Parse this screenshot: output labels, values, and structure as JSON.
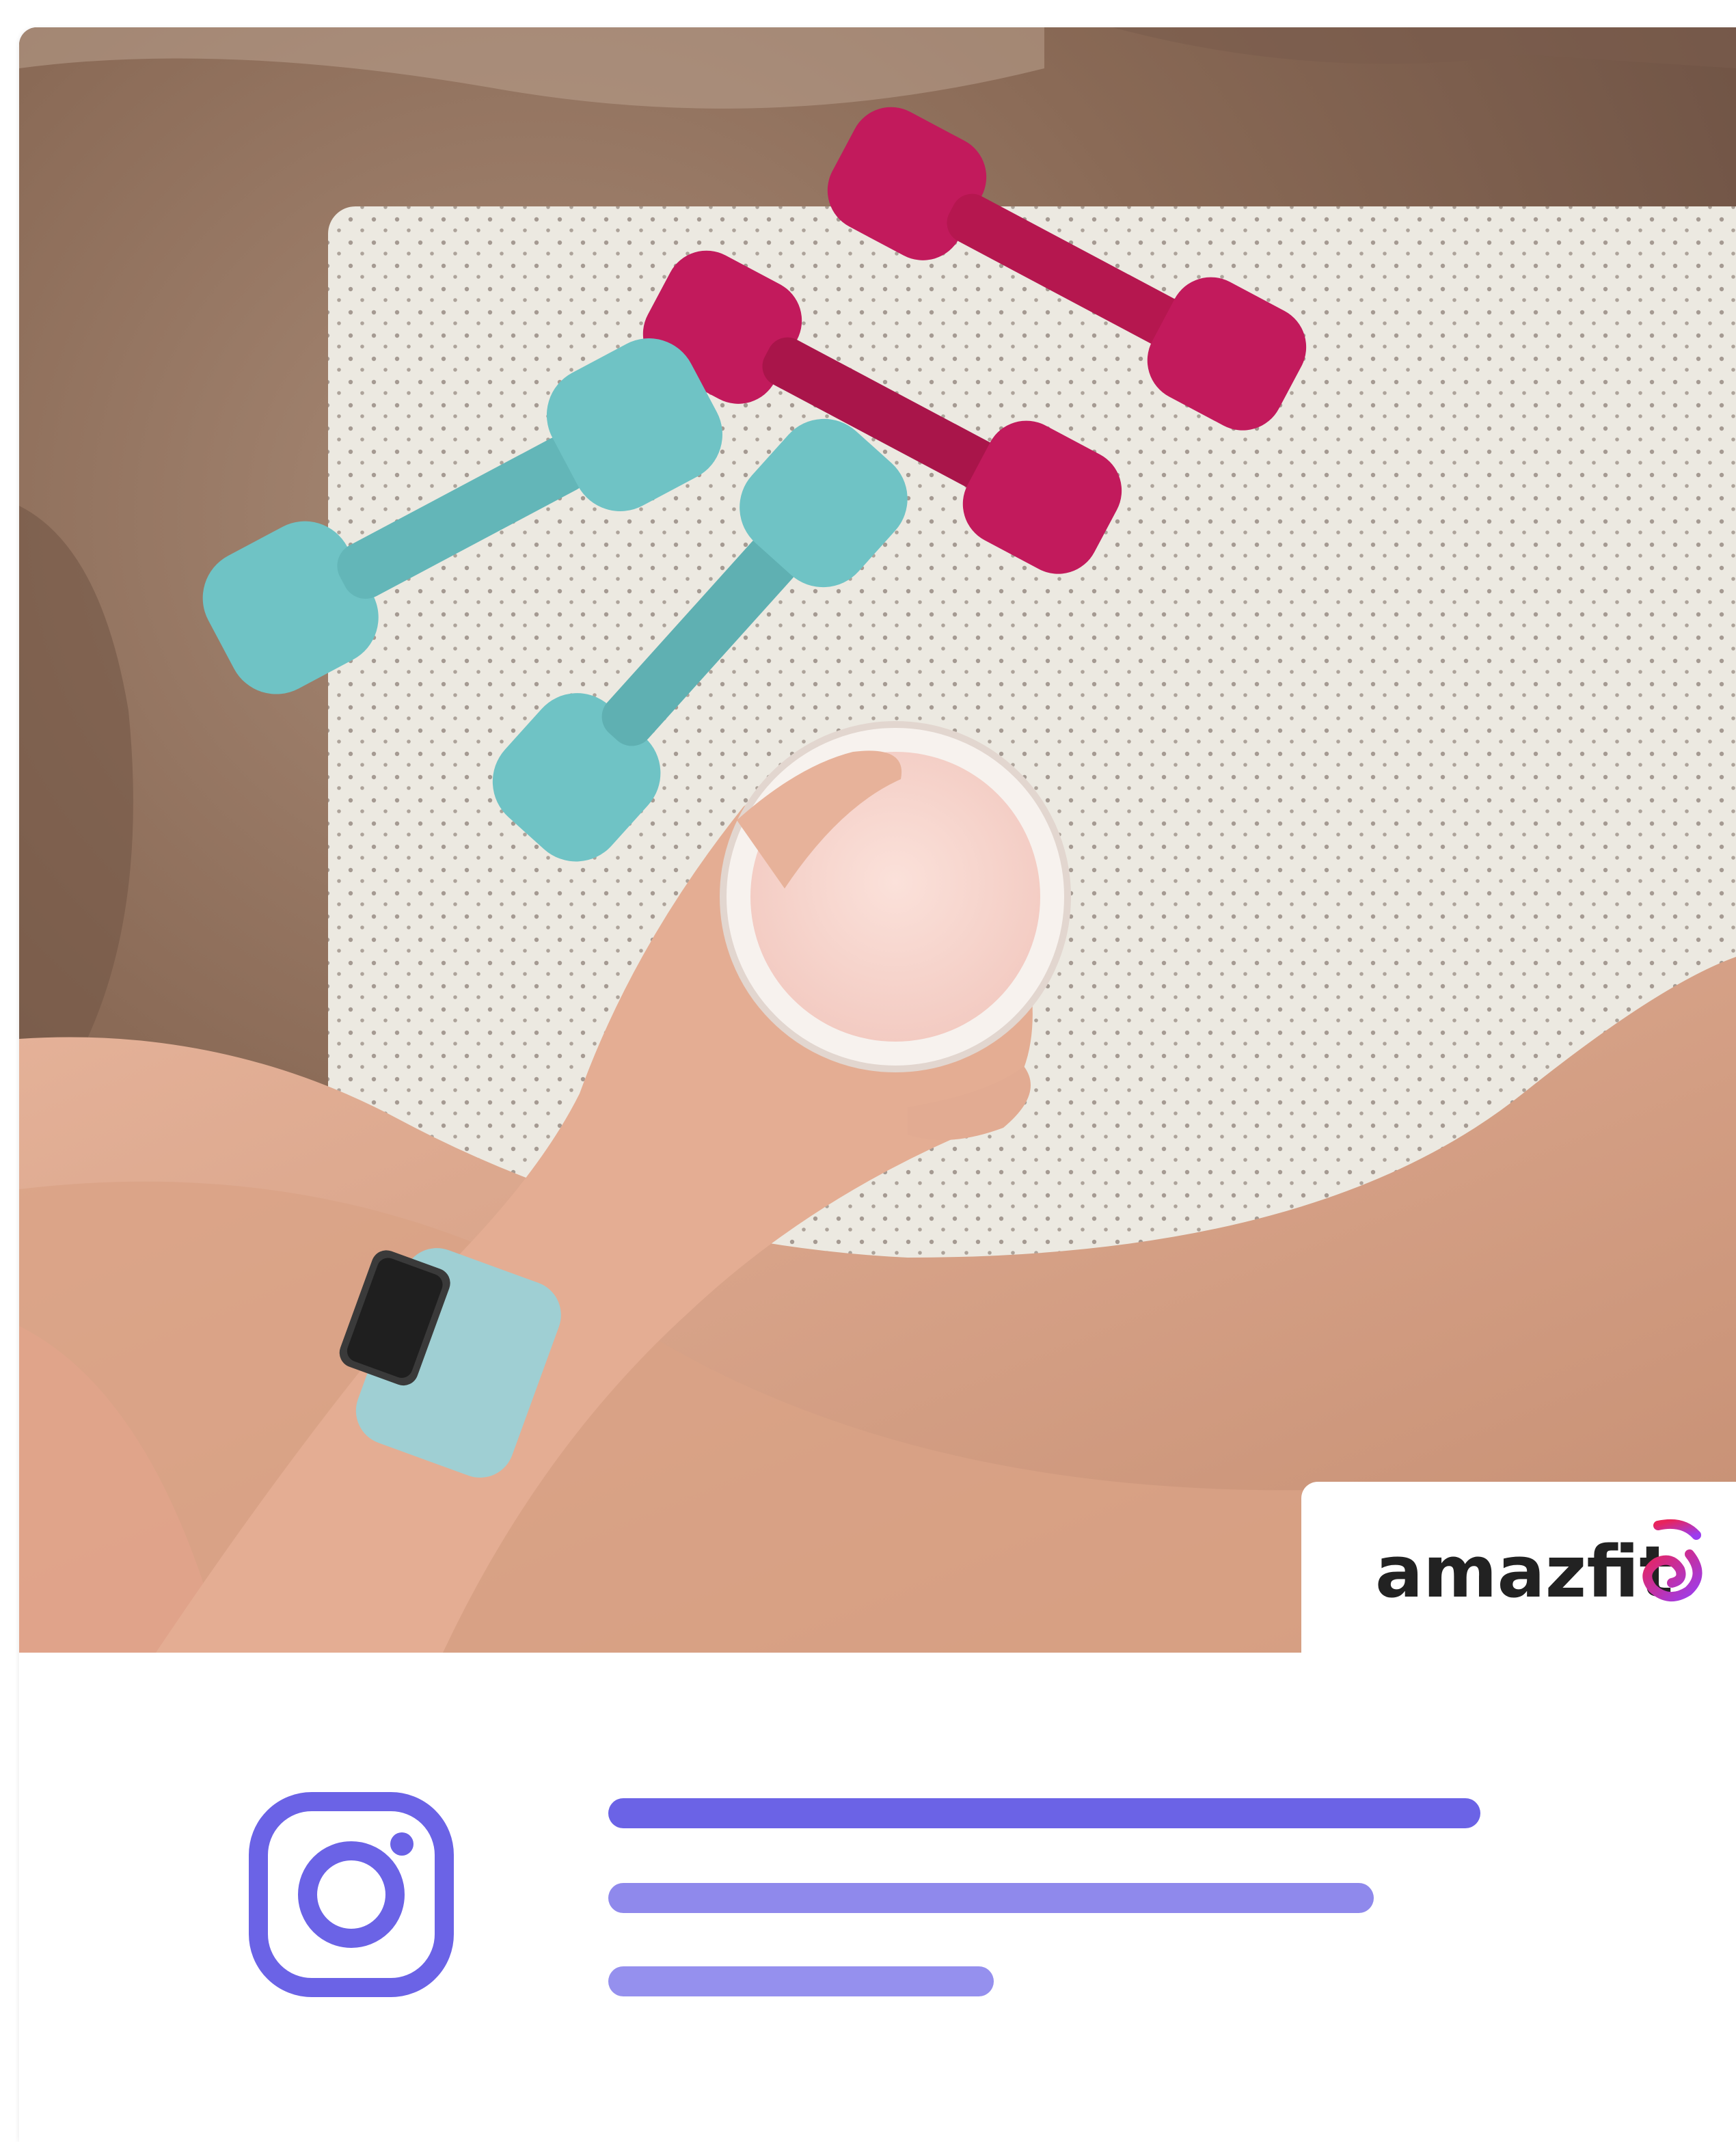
{
  "brand": {
    "name": "amazfit",
    "logo_icon": "amazfit-swirl-icon",
    "gradient_colors": [
      "#e8245c",
      "#9b3df0"
    ],
    "text_color": "#222222"
  },
  "photo": {
    "icon": "photo-dumbbells-smoothie"
  },
  "social": {
    "icon": "instagram-icon",
    "icon_color": "#6b63e6"
  },
  "placeholder_colors": {
    "primary": "#6b63e6",
    "secondary": "#8f89ec"
  }
}
